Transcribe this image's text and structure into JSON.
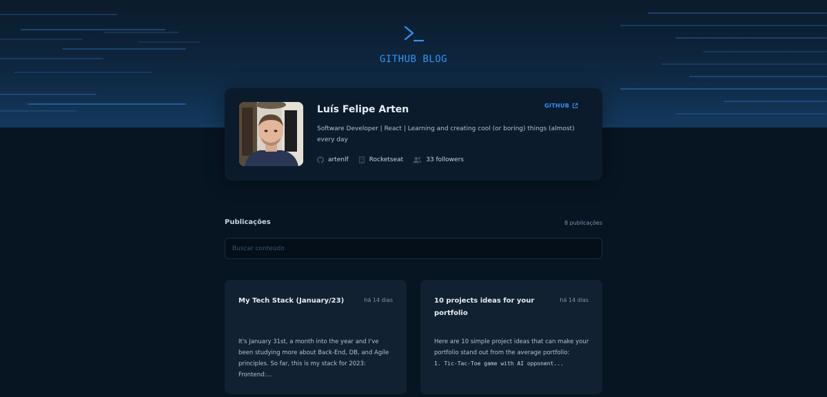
{
  "header": {
    "brand": "GITHUB BLOG",
    "logo_icon": "terminal-prompt-icon",
    "accent": "#3294F8"
  },
  "profile": {
    "name": "Luís Felipe Arten",
    "github_label": "GITHUB",
    "github_icon": "external-link-icon",
    "bio": "Software Developer | React | Learning and creating cool (or boring) things (almost) every day",
    "username": "artenlf",
    "username_icon": "github-icon",
    "company": "Rocketseat",
    "company_icon": "building-icon",
    "followers": "33 followers",
    "followers_icon": "users-icon"
  },
  "publications": {
    "title": "Publicações",
    "count": "8 publicações",
    "search_placeholder": "Buscar conteúdo",
    "posts": [
      {
        "title": "My Tech Stack (January/23)",
        "date": "há 14 dias",
        "excerpt": "It's January 31st, a month into the year and I've been studying more about Back-End, DB, and Agile principles. So far, this is my stack for 2023: Frontend:..."
      },
      {
        "title": "10 projects ideas for your portfolio",
        "date": "há 14 dias",
        "excerpt": "Here are 10 simple project ideas that can make your portfolio stand out from the average portfolio:",
        "code": "1. Tic-Tac-Toe game with AI opponent..."
      }
    ]
  }
}
